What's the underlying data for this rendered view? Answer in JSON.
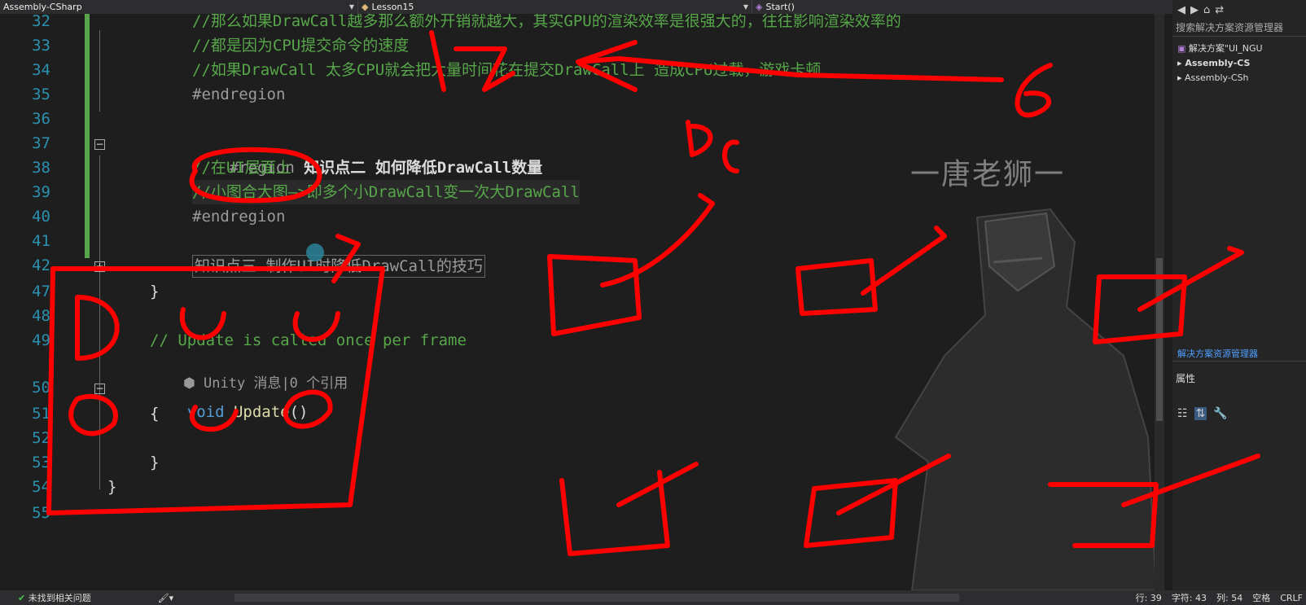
{
  "topbar": {
    "project": "Assembly-CSharp",
    "class": "Lesson15",
    "member": "Start()"
  },
  "gutter": [
    "32",
    "33",
    "34",
    "35",
    "36",
    "37",
    "38",
    "39",
    "40",
    "41",
    "42",
    "47",
    "48",
    "49",
    "50",
    "51",
    "52",
    "53",
    "54",
    "55"
  ],
  "code": {
    "l32": "//那么如果DrawCall越多那么额外开销就越大，其实GPU的渲染效率是很强大的，往往影响渲染效率的",
    "l33": "//都是因为CPU提交命令的速度",
    "l34": "//如果DrawCall 太多CPU就会把大量时间花在提交DrawCall上 造成CPU过载，游戏卡顿",
    "l35": "#endregion",
    "l37_kw": "#region",
    "l37_text": " 知识点二 如何降低DrawCall数量",
    "l38": "//在UI层面上",
    "l39": "//小图合大图—>即多个小DrawCall变一次大DrawCall",
    "l40": "#endregion",
    "l42": "知识点三 制作UI时降低DrawCall的技巧",
    "l47": "}",
    "l49": "// Update is called once per frame",
    "codelens": "Unity 消息|0 个引用",
    "l50_kw": "void",
    "l50_method": " Update",
    "l50_paren": "()",
    "l51": "{",
    "l53": "}",
    "l54": "}"
  },
  "watermark": "一唐老狮一",
  "sidepanel": {
    "search": "搜索解决方案资源管理器",
    "solution": "解决方案\"UI_NGU",
    "item1": "Assembly-CS",
    "item2": "Assembly-CSh",
    "tab": "解决方案资源管理器",
    "properties": "属性"
  },
  "statusbar": {
    "issues": "未找到相关问题",
    "row": "行: 39",
    "char": "字符: 43",
    "col": "列: 54",
    "spaces": "空格",
    "eol": "CRLF"
  },
  "colors": {
    "annotation": "#ff0000",
    "comment": "#57a64a",
    "keyword": "#569cd6",
    "lineNumber": "#2b91af"
  }
}
